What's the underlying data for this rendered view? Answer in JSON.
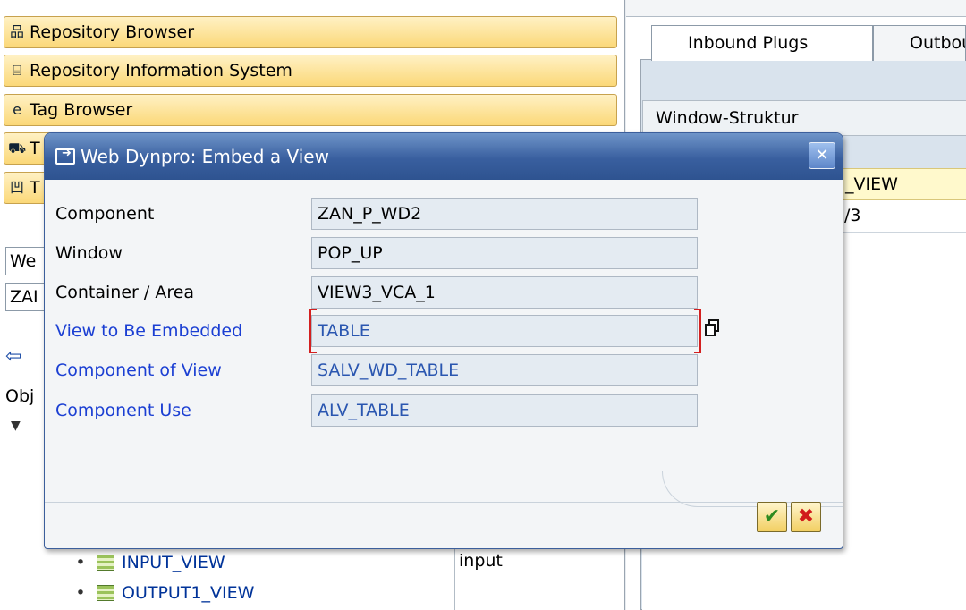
{
  "left_nav": {
    "buttons": [
      {
        "label": "Repository Browser",
        "icon": "repository-browser-icon"
      },
      {
        "label": "Repository Information System",
        "icon": "repository-info-icon"
      },
      {
        "label": "Tag Browser",
        "icon": "tag-browser-icon"
      },
      {
        "label": "T",
        "icon": "transport-icon"
      },
      {
        "label": "T",
        "icon": "test-repository-icon"
      }
    ],
    "stub_inputs": [
      "We",
      "ZAI"
    ],
    "object_header_stub": "Obj",
    "tree": [
      {
        "label": "INPUT_VIEW",
        "description": "input"
      },
      {
        "label": "OUTPUT1_VIEW",
        "description": ""
      }
    ]
  },
  "right_panel": {
    "tabs": [
      "Inbound Plugs",
      "Outbou"
    ],
    "structure_header": "Window-Struktur",
    "rows": [
      "_VIEW",
      "/3"
    ]
  },
  "dialog": {
    "title": "Web Dynpro: Embed a View",
    "fields": [
      {
        "label": "Component",
        "value": "ZAN_P_WD2",
        "required": false
      },
      {
        "label": "Window",
        "value": "POP_UP",
        "required": false
      },
      {
        "label": "Container / Area",
        "value": "VIEW3_VCA_1",
        "required": false
      },
      {
        "label": "View to Be Embedded",
        "value": "TABLE",
        "required": true
      },
      {
        "label": "Component of View",
        "value": "SALV_WD_TABLE",
        "required": true
      },
      {
        "label": "Component Use",
        "value": "ALV_TABLE",
        "required": true
      }
    ],
    "close_glyph": "✕",
    "ok_glyph": "✔",
    "cancel_glyph": "✖"
  },
  "colors": {
    "title_bar": "#395f9f",
    "nav_button": "#fbd878",
    "required_label": "#1b3fd3",
    "selected_row": "#fff9cc"
  }
}
